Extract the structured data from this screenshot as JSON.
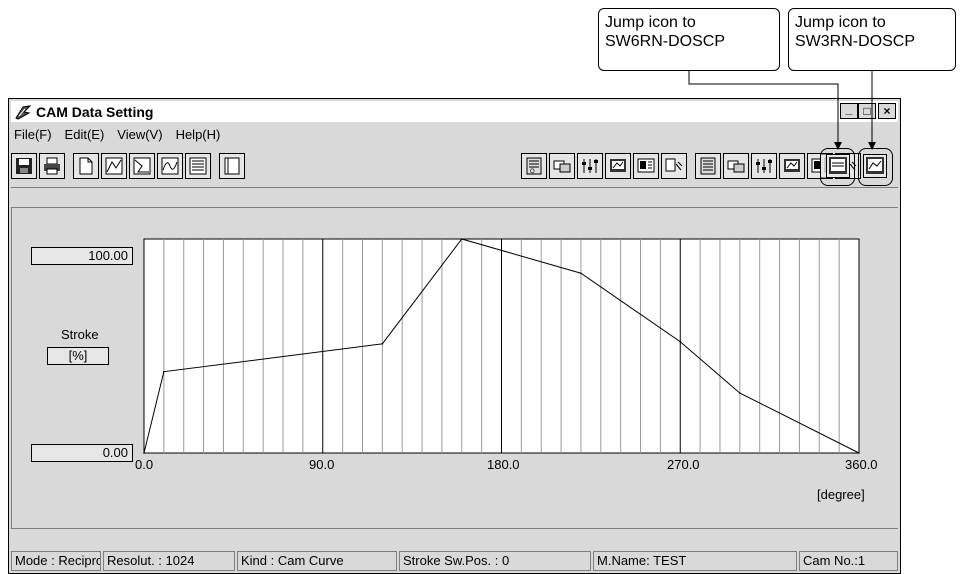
{
  "callouts": [
    {
      "line1": "Jump icon to",
      "line2": "SW6RN-DOSCP"
    },
    {
      "line1": "Jump icon to",
      "line2": "SW3RN-DOSCP"
    }
  ],
  "window": {
    "title": "CAM Data Setting",
    "controls": {
      "minimize": "_",
      "maximize": "□",
      "close": "×"
    }
  },
  "menu": [
    "File(F)",
    "Edit(E)",
    "View(V)",
    "Help(H)"
  ],
  "toolbar_icons": [
    "save-icon",
    "print-icon",
    "new-icon",
    "cam-curve-icon",
    "cam-free-icon",
    "cam-table-icon",
    "data-list-icon",
    "blank-window-icon",
    "upload-a-icon",
    "compare-a-icon",
    "settings-a-icon",
    "display-a-icon",
    "monitor-a-icon",
    "tools-a-icon",
    "upload-b-icon",
    "compare-b-icon",
    "settings-b-icon",
    "display-b-icon",
    "monitor-b-icon",
    "tools-b-icon",
    "disabled-tool-icon",
    "jump-sw6rn-doscp-icon",
    "jump-sw3rn-doscp-icon"
  ],
  "graph": {
    "y_max_label": "100.00",
    "y_min_label": "0.00",
    "stroke_label": "Stroke",
    "stroke_unit": "[%]",
    "x_ticks": [
      "0.0",
      "90.0",
      "180.0",
      "270.0",
      "360.0"
    ],
    "x_unit": "[degree]"
  },
  "chart_data": {
    "type": "line",
    "x": [
      0,
      10,
      120,
      160,
      220,
      270,
      300,
      360
    ],
    "y": [
      0,
      38,
      51,
      100,
      84,
      52,
      28,
      0
    ],
    "xlim": [
      0,
      360
    ],
    "ylim": [
      0,
      100
    ],
    "xlabel": "[degree]",
    "ylabel": "Stroke [%]",
    "x_ticks": [
      0,
      90,
      180,
      270,
      360
    ],
    "grid": true
  },
  "statusbar": {
    "mode": "Mode : Recipro.",
    "resolution": "Resolut. : 1024",
    "kind": "Kind : Cam Curve",
    "stroke_sw_pos": "Stroke Sw.Pos. : 0",
    "machine_name": "M.Name: TEST",
    "cam_no": "Cam No.:1"
  }
}
